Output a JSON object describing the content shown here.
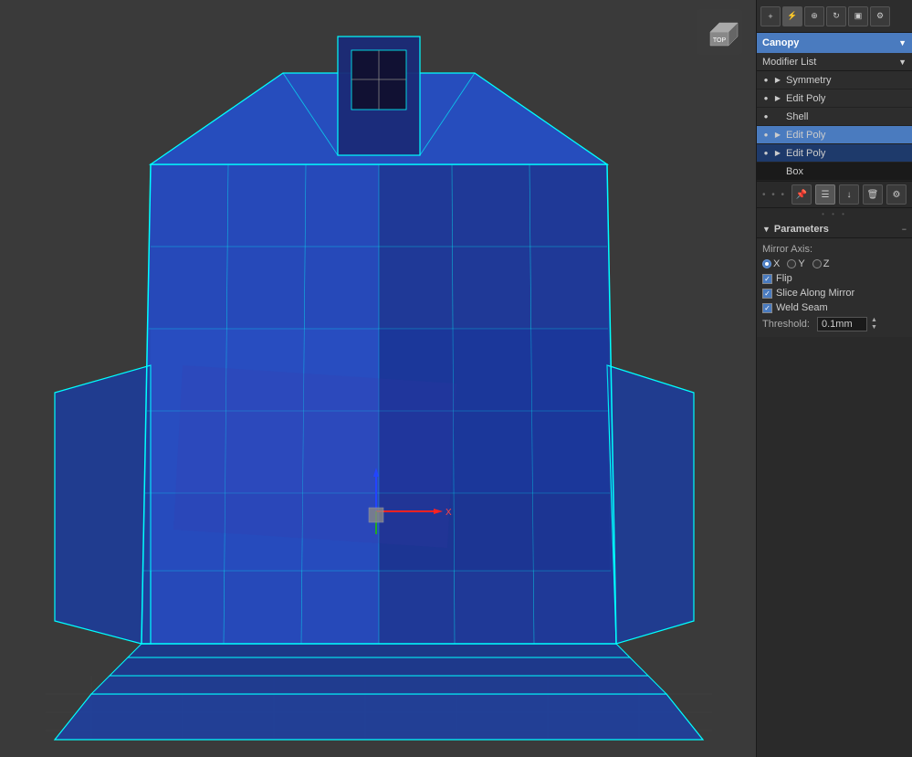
{
  "viewport": {
    "background_color": "#3a3a3a",
    "label": "3D Viewport"
  },
  "navcube": {
    "label": "Top"
  },
  "sidebar": {
    "toolbar_buttons": [
      {
        "icon": "+",
        "name": "create-button",
        "label": "Create"
      },
      {
        "icon": "⚡",
        "name": "modify-button",
        "label": "Modify"
      },
      {
        "icon": "⊕",
        "name": "hierarchy-button",
        "label": "Hierarchy"
      },
      {
        "icon": "↻",
        "name": "motion-button",
        "label": "Motion"
      },
      {
        "icon": "▣",
        "name": "display-button",
        "label": "Display"
      },
      {
        "icon": "⚙",
        "name": "utilities-button",
        "label": "Utilities"
      }
    ],
    "object_name": "Canopy",
    "modifier_list_label": "Modifier List",
    "modifiers": [
      {
        "name": "Symmetry",
        "selected": false,
        "eye": true,
        "arrow": true
      },
      {
        "name": "Edit Poly",
        "selected": false,
        "eye": true,
        "arrow": true
      },
      {
        "name": "Shell",
        "selected": false,
        "eye": true,
        "arrow": false
      },
      {
        "name": "Edit Poly",
        "selected": true,
        "eye": true,
        "arrow": true
      },
      {
        "name": "Edit Poly",
        "selected": false,
        "eye": true,
        "arrow": true
      },
      {
        "name": "Box",
        "selected": false,
        "eye": false,
        "arrow": false,
        "is_box": true
      }
    ],
    "modifier_toolbar": [
      {
        "icon": "🔧",
        "name": "pin-button"
      },
      {
        "icon": "☰",
        "name": "list-button",
        "active": true
      },
      {
        "icon": "↓",
        "name": "move-down-button"
      },
      {
        "icon": "🗑",
        "name": "delete-button"
      },
      {
        "icon": "⚙",
        "name": "settings-button"
      }
    ],
    "parameters": {
      "title": "Parameters",
      "mirror_axis_label": "Mirror Axis:",
      "axes": [
        {
          "label": "X",
          "selected": true
        },
        {
          "label": "Y",
          "selected": false
        },
        {
          "label": "Z",
          "selected": false
        }
      ],
      "flip_label": "Flip",
      "flip_checked": true,
      "slice_along_mirror_label": "Slice Along Mirror",
      "slice_along_mirror_checked": true,
      "weld_seam_label": "Weld Seam",
      "weld_seam_checked": true,
      "threshold_label": "Threshold:",
      "threshold_value": "0.1mm"
    }
  }
}
